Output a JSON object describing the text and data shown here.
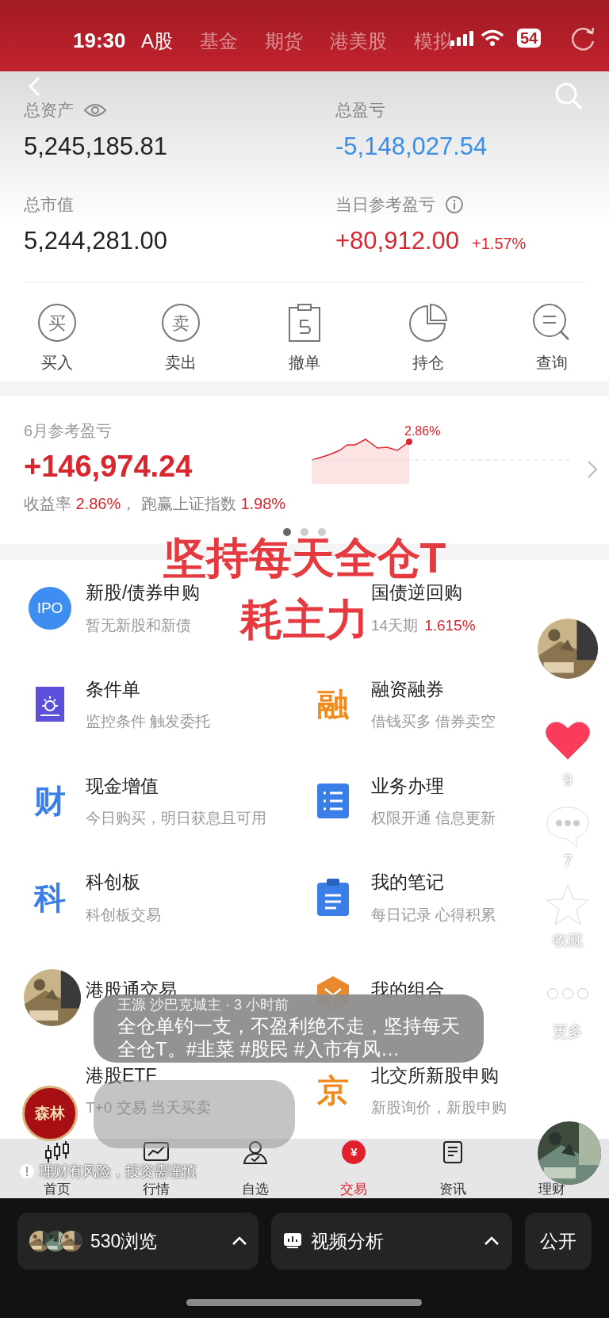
{
  "status_bar": {
    "time": "19:30",
    "battery": "54"
  },
  "top_tabs": [
    {
      "label": "A股",
      "selected": true
    },
    {
      "label": "基金",
      "selected": false
    },
    {
      "label": "期货",
      "selected": false
    },
    {
      "label": "港美股",
      "selected": false
    },
    {
      "label": "模拟",
      "selected": false
    }
  ],
  "assets": [
    {
      "label": "总资产",
      "value": "5,245,185.81",
      "color": "#222222",
      "kind": "eye"
    },
    {
      "label": "总盈亏",
      "value": "-5,148,027.54",
      "color": "#3a8ee6",
      "kind": "plain"
    },
    {
      "label": "总市值",
      "value": "5,244,281.00",
      "color": "#222222",
      "kind": "plain"
    },
    {
      "label": "当日参考盈亏",
      "value": "+80,912.00",
      "color": "#d9262f",
      "kind": "info",
      "change": "+1.57%"
    }
  ],
  "actions": [
    {
      "label": "买入",
      "kind": "glyph",
      "glyph": "买"
    },
    {
      "label": "卖出",
      "kind": "glyph",
      "glyph": "卖"
    },
    {
      "label": "撤单",
      "kind": "undo"
    },
    {
      "label": "持仓",
      "kind": "pie"
    },
    {
      "label": "查询",
      "kind": "query"
    }
  ],
  "monthly": {
    "label": "6月参考盈亏",
    "value": "+146,974.24",
    "chart_label": "2.86%",
    "rate_parts": [
      {
        "text": "收益率 ",
        "color": "#888888"
      },
      {
        "text": "2.86%",
        "color": "#d9262f"
      },
      {
        "text": "， 跑赢上证指数 ",
        "color": "#888888"
      },
      {
        "text": "1.98%",
        "color": "#d9262f"
      }
    ],
    "pages": [
      {
        "selected": true
      },
      {
        "selected": false
      },
      {
        "selected": false
      }
    ]
  },
  "services": [
    {
      "title": "新股/债券申购",
      "subtitle": "暂无新股和新债",
      "kind": "ipo",
      "glyph": "IPO"
    },
    {
      "title": "国债逆回购",
      "subtitle": "14天期",
      "rate": "1.615%",
      "kind": "none"
    },
    {
      "title": "条件单",
      "subtitle": "监控条件 触发委托",
      "kind": "condition"
    },
    {
      "title": "融资融券",
      "subtitle": "借钱买多 借券卖空",
      "kind": "glyph",
      "glyph": "融",
      "color": "#f08a1c"
    },
    {
      "title": "现金增值",
      "subtitle": "今日购买，明日获息且可用",
      "kind": "glyph",
      "glyph": "财",
      "color": "#3a7ee8"
    },
    {
      "title": "业务办理",
      "subtitle": "权限开通 信息更新",
      "kind": "list"
    },
    {
      "title": "科创板",
      "subtitle": "科创板交易",
      "kind": "glyph",
      "glyph": "科",
      "color": "#3a7ee8"
    },
    {
      "title": "我的笔记",
      "subtitle": "每日记录 心得积累",
      "kind": "note"
    },
    {
      "title": "港股通交易",
      "kind": "none"
    },
    {
      "title": "我的组合",
      "kind": "hexagon"
    },
    {
      "title": "港股ETF",
      "subtitle": "T+0 交易 当天买卖",
      "kind": "none"
    },
    {
      "title": "北交所新股申购",
      "subtitle": "新股询价，新股申购",
      "kind": "glyph",
      "glyph": "京",
      "color": "#f08a1c"
    }
  ],
  "nav": [
    {
      "label": "首页",
      "kind": "candles",
      "selected": false
    },
    {
      "label": "行情",
      "kind": "chart",
      "selected": false
    },
    {
      "label": "自选",
      "kind": "person",
      "selected": false
    },
    {
      "label": "交易",
      "kind": "yuan",
      "glyph": "¥",
      "selected": true
    },
    {
      "label": "资讯",
      "kind": "doc",
      "selected": false
    },
    {
      "label": "理财",
      "kind": "none",
      "selected": false
    }
  ],
  "disclaimer": "理财有风险，投资需谨慎",
  "video_overlay": {
    "caption_lines": [
      "坚持每天全仓T",
      "耗主力"
    ],
    "comment": {
      "author": "王源 沙巴克城主 · 3 小时前",
      "text": "全仓单钓一支，不盈利绝不走，坚持每天全仓T。#韭菜 #股民 #入市有风…"
    },
    "badge": "森林",
    "liked": true,
    "likes": "9",
    "comments": "7",
    "favorite": "收藏",
    "more": "更多"
  },
  "bottom_bar": {
    "views": "530浏览",
    "analysis": "视频分析",
    "publish": "公开"
  }
}
